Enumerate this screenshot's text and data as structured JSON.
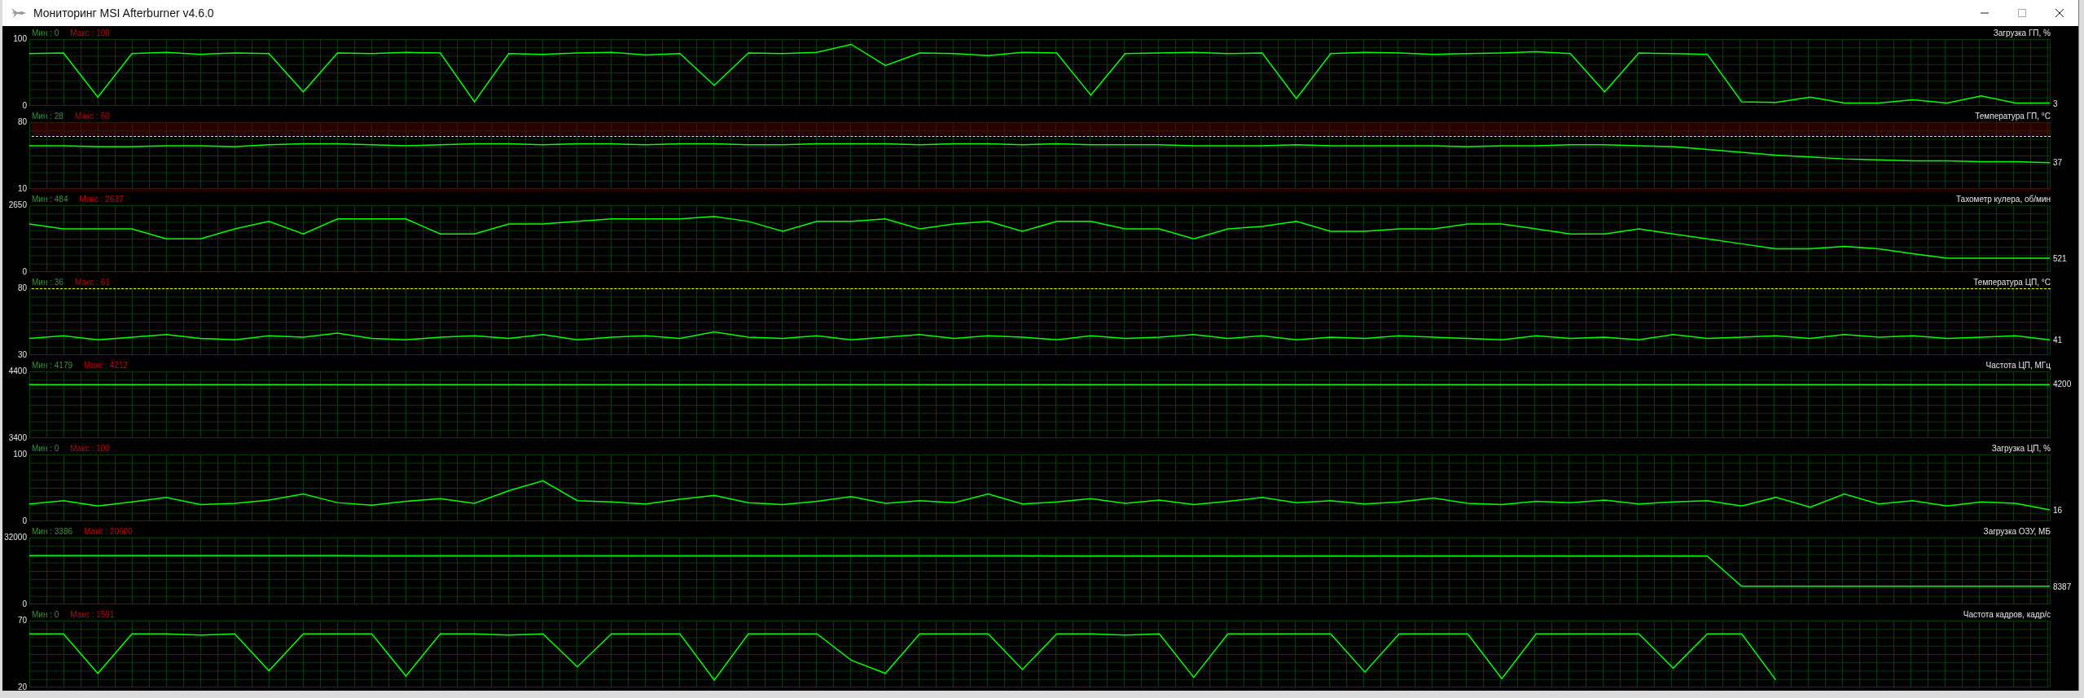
{
  "window": {
    "title": "Мониторинг MSI Afterburner v4.6.0"
  },
  "graphs": [
    {
      "min_label": "Мин : 0",
      "max_label": "Макс : 100",
      "current": "3",
      "chart_data": {
        "type": "line",
        "title": "Загрузка ГП, %",
        "ylim": [
          0,
          100
        ],
        "yticks": [
          0,
          100
        ],
        "series": [
          {
            "color": "#00ff00",
            "values": [
              78,
              79,
              12,
              78,
              80,
              77,
              79,
              78,
              20,
              79,
              78,
              80,
              79,
              5,
              78,
              77,
              79,
              80,
              76,
              78,
              30,
              79,
              78,
              80,
              92,
              60,
              79,
              78,
              75,
              80,
              79,
              15,
              78,
              79,
              80,
              78,
              79,
              10,
              78,
              80,
              79,
              77,
              78,
              79,
              81,
              78,
              20,
              79,
              78,
              77,
              5,
              4,
              12,
              3,
              3,
              8,
              3,
              14,
              3,
              3
            ]
          }
        ]
      }
    },
    {
      "min_label": "Мин : 28",
      "max_label": "Макс : 60",
      "current": "37",
      "alarm_zone": true,
      "chart_data": {
        "type": "line",
        "title": "Температура ГП, °C",
        "ylim": [
          10,
          80
        ],
        "yticks": [
          10,
          80
        ],
        "series": [
          {
            "color": "#00ff00",
            "values": [
              55,
              55,
              54,
              54,
              55,
              55,
              54,
              56,
              57,
              57,
              56,
              55,
              56,
              57,
              57,
              56,
              57,
              57,
              56,
              57,
              57,
              56,
              56,
              57,
              57,
              57,
              56,
              57,
              57,
              56,
              57,
              56,
              56,
              56,
              55,
              55,
              55,
              56,
              55,
              55,
              55,
              55,
              54,
              55,
              55,
              56,
              56,
              55,
              54,
              51,
              48,
              45,
              43,
              41,
              40,
              39,
              39,
              38,
              38,
              37
            ]
          }
        ]
      }
    },
    {
      "min_label": "Мин : 484",
      "max_label": "Макс : 2637",
      "current": "521",
      "chart_data": {
        "type": "line",
        "title": "Тахометр кулера, об/мин",
        "ylim": [
          0,
          2650
        ],
        "yticks": [
          0,
          2650
        ],
        "series": [
          {
            "color": "#00ff00",
            "values": [
              1900,
              1700,
              1700,
              1700,
              1300,
              1300,
              1700,
              2000,
              1500,
              2100,
              2100,
              2100,
              1500,
              1500,
              1900,
              1900,
              2000,
              2100,
              2100,
              2100,
              2200,
              2000,
              1600,
              2000,
              2000,
              2100,
              1700,
              1900,
              2000,
              1600,
              2000,
              2000,
              1700,
              1700,
              1300,
              1700,
              1800,
              2000,
              1600,
              1600,
              1700,
              1700,
              1900,
              1900,
              1700,
              1500,
              1500,
              1700,
              1500,
              1300,
              1100,
              900,
              900,
              1000,
              900,
              700,
              521,
              521,
              521,
              521
            ]
          }
        ]
      }
    },
    {
      "min_label": "Мин : 36",
      "max_label": "Макс : 61",
      "current": "41",
      "limit_line": true,
      "chart_data": {
        "type": "line",
        "title": "Температура ЦП, °C",
        "ylim": [
          30,
          80
        ],
        "yticks": [
          30,
          80
        ],
        "series": [
          {
            "color": "#00ff00",
            "values": [
              42,
              44,
              41,
              43,
              45,
              42,
              41,
              44,
              43,
              46,
              42,
              41,
              43,
              44,
              42,
              45,
              41,
              43,
              44,
              42,
              47,
              43,
              42,
              44,
              41,
              43,
              45,
              42,
              44,
              43,
              41,
              44,
              42,
              43,
              45,
              42,
              44,
              41,
              43,
              42,
              44,
              43,
              42,
              41,
              44,
              42,
              43,
              41,
              45,
              42,
              43,
              44,
              42,
              45,
              43,
              44,
              42,
              43,
              44,
              41
            ]
          }
        ]
      }
    },
    {
      "min_label": "Мин : 4179",
      "max_label": "Макс : 4212",
      "current": "4200",
      "chart_data": {
        "type": "line",
        "title": "Частота ЦП, МГц",
        "ylim": [
          3400,
          4400
        ],
        "yticks": [
          3400,
          4400
        ],
        "series": [
          {
            "color": "#00ff00",
            "values": [
              4200,
              4200,
              4200,
              4200,
              4200,
              4200,
              4200,
              4200,
              4200,
              4200,
              4200,
              4200,
              4200,
              4200,
              4200,
              4200,
              4200,
              4200,
              4200,
              4200,
              4200,
              4200,
              4200,
              4200,
              4200,
              4200,
              4200,
              4200,
              4200,
              4200,
              4200,
              4200,
              4200,
              4200,
              4200,
              4200,
              4200,
              4200,
              4200,
              4200,
              4200,
              4200,
              4200,
              4200,
              4200,
              4200,
              4200,
              4200,
              4200,
              4200,
              4200,
              4200,
              4200,
              4200,
              4200,
              4200,
              4200,
              4200,
              4200,
              4200
            ]
          }
        ]
      }
    },
    {
      "min_label": "Мин : 0",
      "max_label": "Макс : 100",
      "current": "16",
      "chart_data": {
        "type": "line",
        "title": "Загрузка ЦП, %",
        "ylim": [
          0,
          100
        ],
        "yticks": [
          0,
          100
        ],
        "series": [
          {
            "color": "#00ff00",
            "values": [
              25,
              30,
              22,
              28,
              35,
              24,
              26,
              31,
              40,
              27,
              23,
              29,
              33,
              26,
              45,
              60,
              30,
              28,
              25,
              32,
              38,
              27,
              24,
              29,
              36,
              26,
              30,
              27,
              40,
              25,
              28,
              33,
              26,
              31,
              24,
              29,
              35,
              27,
              30,
              25,
              28,
              34,
              26,
              24,
              29,
              27,
              31,
              25,
              28,
              30,
              22,
              35,
              20,
              40,
              25,
              30,
              22,
              28,
              26,
              16
            ]
          }
        ]
      }
    },
    {
      "min_label": "Мин : 3386",
      "max_label": "Макс : 20680",
      "current": "8387",
      "chart_data": {
        "type": "line",
        "title": "Загрузка ОЗУ, МБ",
        "ylim": [
          0,
          32000
        ],
        "yticks": [
          0,
          32000
        ],
        "series": [
          {
            "color": "#00ff00",
            "values": [
              23200,
              23200,
              23200,
              23200,
              23200,
              23200,
              23200,
              23200,
              23200,
              23200,
              23100,
              23100,
              23100,
              23100,
              23100,
              23100,
              23100,
              23100,
              23100,
              23100,
              23100,
              23100,
              23100,
              23100,
              23100,
              23100,
              23100,
              23100,
              23100,
              23100,
              23000,
              23000,
              23000,
              23000,
              23000,
              23000,
              23000,
              23000,
              23000,
              23000,
              23000,
              23000,
              23000,
              23000,
              23000,
              23000,
              23000,
              23000,
              23000,
              23000,
              8387,
              8387,
              8387,
              8387,
              8387,
              8387,
              8387,
              8387,
              8387,
              8387
            ]
          }
        ]
      }
    },
    {
      "min_label": "Мин : 0",
      "max_label": "Макс : 1591",
      "chart_data": {
        "type": "line",
        "title": "Частота кадров, кадр/с",
        "ylim": [
          20,
          70
        ],
        "yticks": [
          20,
          70
        ],
        "series": [
          {
            "color": "#00ff00",
            "values": [
              60,
              60,
              30,
              60,
              60,
              59,
              60,
              32,
              60,
              60,
              60,
              28,
              60,
              60,
              59,
              60,
              35,
              60,
              60,
              60,
              25,
              60,
              60,
              60,
              40,
              30,
              60,
              60,
              60,
              33,
              60,
              60,
              59,
              60,
              27,
              60,
              60,
              60,
              60,
              31,
              60,
              60,
              60,
              26,
              60,
              60,
              60,
              60,
              34,
              60,
              60,
              25,
              null,
              null,
              null,
              null,
              null,
              null,
              null,
              null
            ]
          }
        ]
      }
    }
  ]
}
